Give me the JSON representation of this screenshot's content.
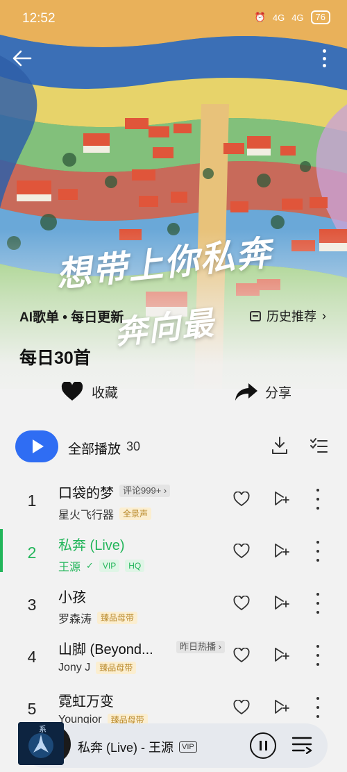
{
  "status_bar": {
    "time": "12:52",
    "signal_1": "4G",
    "signal_2": "4G",
    "battery": "76"
  },
  "cover": {
    "overlay_line1": "想带上你私奔",
    "overlay_line2": "奔向最"
  },
  "playlist": {
    "tag": "AI歌单 • 每日更新",
    "history_label": "历史推荐",
    "title": "每日30首",
    "collect_label": "收藏",
    "share_label": "分享"
  },
  "play_all": {
    "label": "全部播放",
    "count": "30"
  },
  "songs": [
    {
      "index": "1",
      "name": "口袋的梦",
      "artist": "星火飞行器",
      "tag": "全景声",
      "inline_badge": "评论999+"
    },
    {
      "index": "2",
      "name": "私奔 (Live)",
      "artist": "王源",
      "tags": [
        "VIP",
        "HQ"
      ]
    },
    {
      "index": "3",
      "name": "小孩",
      "artist": "罗森涛",
      "tag": "臻品母带"
    },
    {
      "index": "4",
      "name": "山脚 (Beyond...",
      "artist": "Jony J",
      "tag": "臻品母带",
      "inline_badge": "昨日热播"
    },
    {
      "index": "5",
      "name": "霓虹万变",
      "artist": "Youngior",
      "tag": "臻品母带"
    }
  ],
  "now_playing": {
    "title": "私奔 (Live) - 王源",
    "badge": "VIP",
    "cover_text": "系"
  },
  "colors": {
    "accent_green": "#22b55a",
    "play_blue": "#2f6df3",
    "gold_badge": "#b9892a"
  }
}
